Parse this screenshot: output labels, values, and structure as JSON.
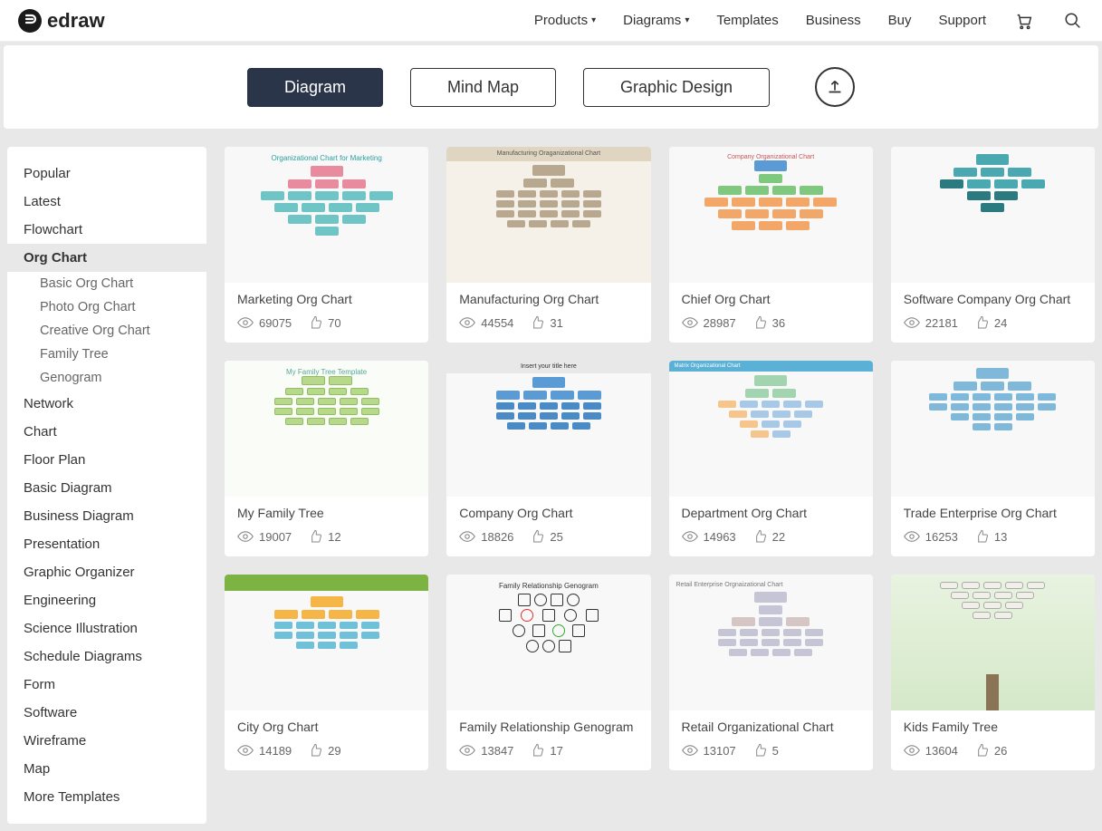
{
  "brand": "edraw",
  "nav": {
    "products": "Products",
    "diagrams": "Diagrams",
    "templates": "Templates",
    "business": "Business",
    "buy": "Buy",
    "support": "Support"
  },
  "tabs": {
    "diagram": "Diagram",
    "mindmap": "Mind Map",
    "graphic": "Graphic Design"
  },
  "sidebar": {
    "items": [
      "Popular",
      "Latest",
      "Flowchart",
      "Org Chart",
      "Network",
      "Chart",
      "Floor Plan",
      "Basic Diagram",
      "Business Diagram",
      "Presentation",
      "Graphic Organizer",
      "Engineering",
      "Science Illustration",
      "Schedule Diagrams",
      "Form",
      "Software",
      "Wireframe",
      "Map",
      "More Templates"
    ],
    "active_index": 3,
    "sub": [
      "Basic Org Chart",
      "Photo Org Chart",
      "Creative Org Chart",
      "Family Tree",
      "Genogram"
    ]
  },
  "cards": [
    {
      "title": "Marketing Org Chart",
      "views": "69075",
      "likes": "70",
      "thumb_title": "Organizational Chart for Marketing"
    },
    {
      "title": "Manufacturing Org Chart",
      "views": "44554",
      "likes": "31",
      "thumb_title": "Manufacturing Oraganizational Chart"
    },
    {
      "title": "Chief Org Chart",
      "views": "28987",
      "likes": "36",
      "thumb_title": "Company Organizational Chart"
    },
    {
      "title": "Software Company Org Chart",
      "views": "22181",
      "likes": "24",
      "thumb_title": ""
    },
    {
      "title": "My Family Tree",
      "views": "19007",
      "likes": "12",
      "thumb_title": "My Family Tree Template"
    },
    {
      "title": "Company Org Chart",
      "views": "18826",
      "likes": "25",
      "thumb_title": "Insert your title here"
    },
    {
      "title": "Department Org Chart",
      "views": "14963",
      "likes": "22",
      "thumb_title": "Matrix Organizational Chart"
    },
    {
      "title": "Trade Enterprise Org Chart",
      "views": "16253",
      "likes": "13",
      "thumb_title": ""
    },
    {
      "title": "City Org Chart",
      "views": "14189",
      "likes": "29",
      "thumb_title": ""
    },
    {
      "title": "Family Relationship Genogram",
      "views": "13847",
      "likes": "17",
      "thumb_title": "Family Relationship Genogram"
    },
    {
      "title": "Retail Organizational Chart",
      "views": "13107",
      "likes": "5",
      "thumb_title": "Retail Enterprise Orgnaizational Chart"
    },
    {
      "title": "Kids Family Tree",
      "views": "13604",
      "likes": "26",
      "thumb_title": ""
    }
  ]
}
